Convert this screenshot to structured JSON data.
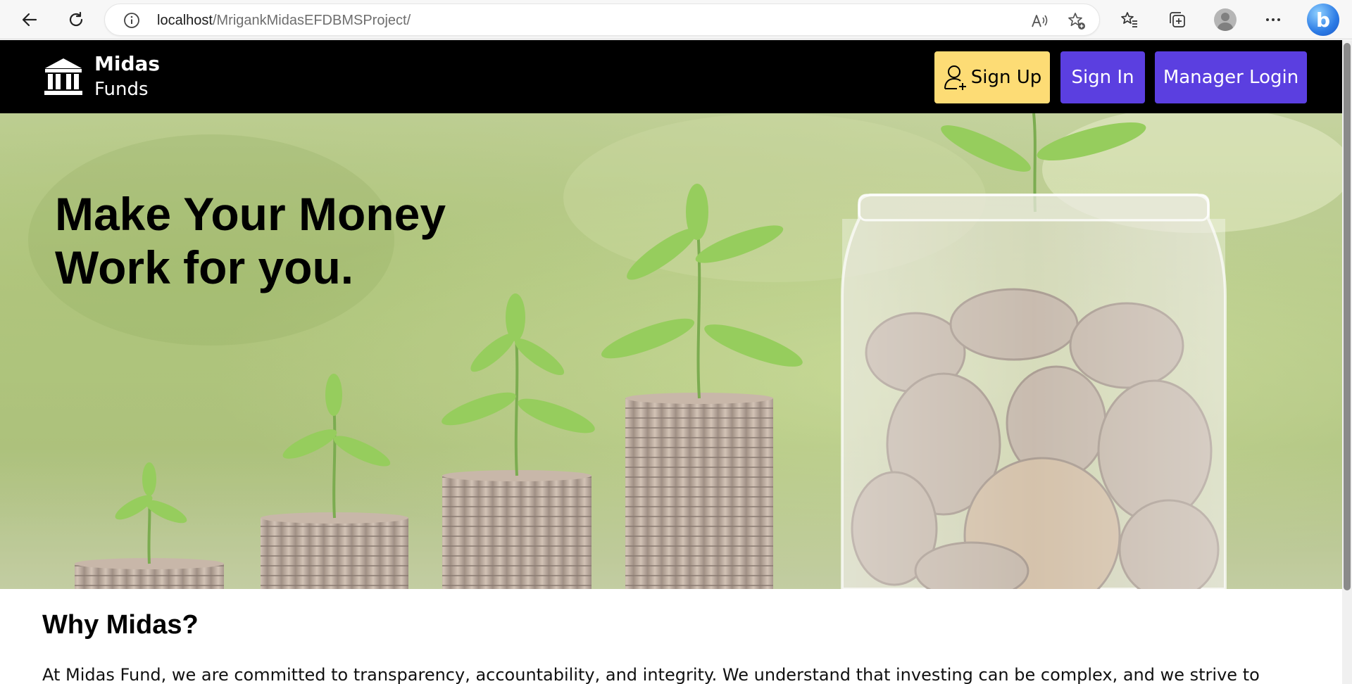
{
  "browser": {
    "url_host": "localhost",
    "url_path": "/MrigankMidasEFDBMSProject/"
  },
  "site": {
    "logo_name": "Midas",
    "logo_sub": "Funds"
  },
  "nav": {
    "signup_label": "Sign Up",
    "signin_label": "Sign In",
    "manager_label": "Manager Login"
  },
  "hero": {
    "heading_line1": "Make Your Money",
    "heading_line2": "Work for you."
  },
  "about": {
    "title": "Why Midas?",
    "text": "At Midas Fund, we are committed to transparency, accountability, and integrity. We understand that investing can be complex, and we strive to"
  },
  "colors": {
    "navbar": "#000000",
    "signup_bg": "#fddc75",
    "primary_btn": "#5b3fe0"
  }
}
